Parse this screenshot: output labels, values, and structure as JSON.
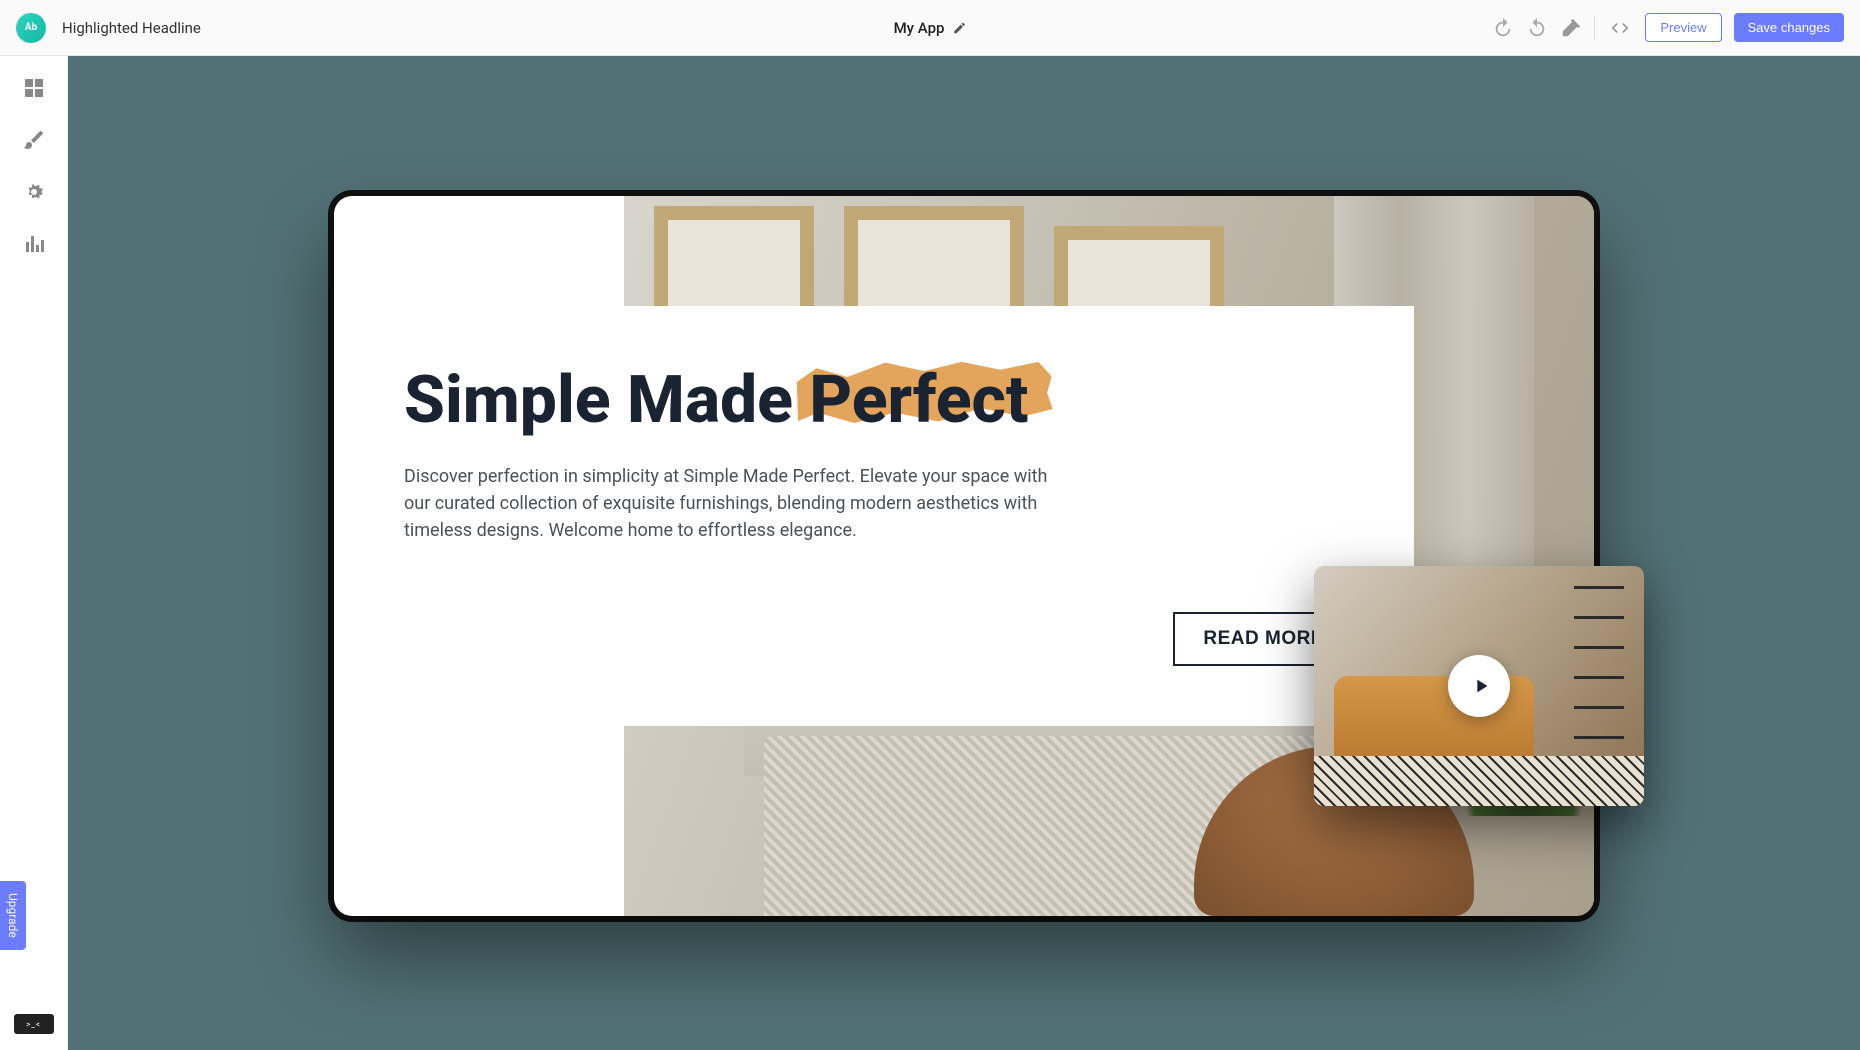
{
  "topbar": {
    "logo_text": "Ab",
    "project_name": "Highlighted Headline",
    "app_name": "My App",
    "preview_label": "Preview",
    "save_label": "Save changes"
  },
  "sidebar": {
    "upgrade_label": "Upgrade",
    "widget_label": ">_<"
  },
  "hero": {
    "headline_pre": "Simple Made ",
    "headline_highlight": "Perfect",
    "description": "Discover perfection in simplicity at Simple Made Perfect. Elevate your space with our curated collection of exquisite furnishings, blending modern aesthetics with timeless designs. Welcome home to effortless elegance.",
    "cta_label": "READ MORE"
  },
  "icons": {
    "logo": "logo-icon",
    "edit": "pencil-icon",
    "undo": "undo-icon",
    "redo": "redo-icon",
    "hammer": "hammer-icon",
    "code": "code-icon",
    "grid": "grid-icon",
    "brush": "brush-icon",
    "gear": "gear-icon",
    "chart": "chart-icon",
    "play": "play-icon"
  }
}
